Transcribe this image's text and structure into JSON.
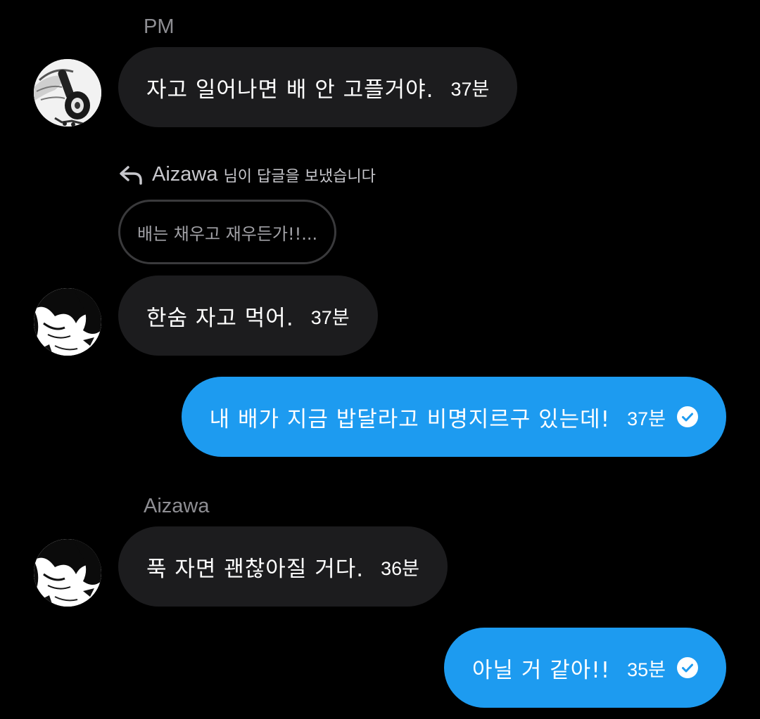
{
  "thread": {
    "first_sender": "PM",
    "second_sender": "Aizawa"
  },
  "messages": [
    {
      "text": "자고 일어나면 배 안 고플거야.",
      "time": "37분"
    },
    {
      "text": "한숨 자고 먹어.",
      "time": "37분"
    },
    {
      "text": "내 배가 지금 밥달라고 비명지르구 있는데!",
      "time": "37분"
    },
    {
      "text": "푹 자면 괜찮아질 거다.",
      "time": "36분"
    },
    {
      "text": "아닐 거 같아!!",
      "time": "35분"
    }
  ],
  "reply": {
    "name": "Aizawa",
    "suffix": "님이 답글을 보냈습니다",
    "quote": "배는 채우고 재우든가!!..."
  },
  "icons": {
    "reply": "reply-arrow-icon",
    "read": "read-check-icon"
  },
  "colors": {
    "background": "#000000",
    "incoming_bubble": "#1c1c1e",
    "outgoing_bubble": "#1d9bf0",
    "muted_text": "#8e8e93"
  }
}
